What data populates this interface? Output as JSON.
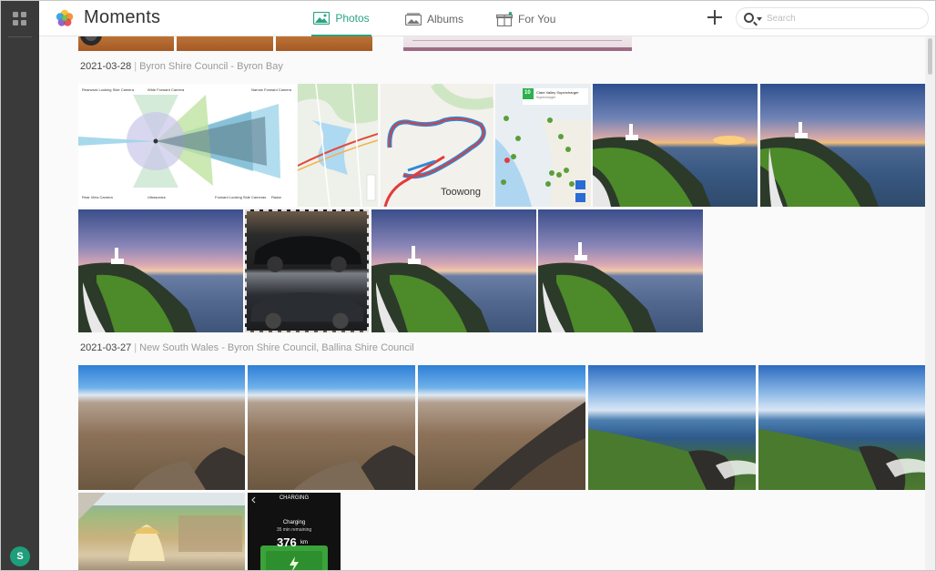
{
  "app": {
    "title": "Moments",
    "user_initial": "S",
    "accent_color": "#2aa383"
  },
  "nav": {
    "tabs": [
      {
        "label": "Photos",
        "icon": "photos-icon",
        "active": true
      },
      {
        "label": "Albums",
        "icon": "albums-icon",
        "active": false
      },
      {
        "label": "For You",
        "icon": "gift-icon",
        "active": false
      }
    ]
  },
  "toolbar": {
    "add_icon": "plus-icon",
    "search_icon": "search-icon",
    "search_placeholder": "Search"
  },
  "moments": [
    {
      "date": "2021-03-28",
      "place": "Byron Shire Council - Byron Bay"
    },
    {
      "date": "2021-03-27",
      "place": "New South Wales - Byron Shire Council, Ballina Shire Council"
    }
  ],
  "map_labels": {
    "suburb": "Toowong",
    "charger_count": "10",
    "charger_name": "Clare Valley Supercharger",
    "charger_sub": "Supercharger"
  },
  "charging_screen": {
    "title": "CHARGING",
    "status": "Charging",
    "remaining": "35 min remaining",
    "range": "376",
    "range_unit": "km"
  },
  "radar_labels": {
    "top_left": "Rearward Looking Side Camera",
    "top_mid": "Wide Forward Camera",
    "top_right": "Narrow Forward Camera",
    "bottom_left": "Rear View Camera",
    "bottom_mid": "Ultrasonics",
    "bottom_mid2": "Forward Looking Side Cameras",
    "bottom_right": "Radar"
  }
}
